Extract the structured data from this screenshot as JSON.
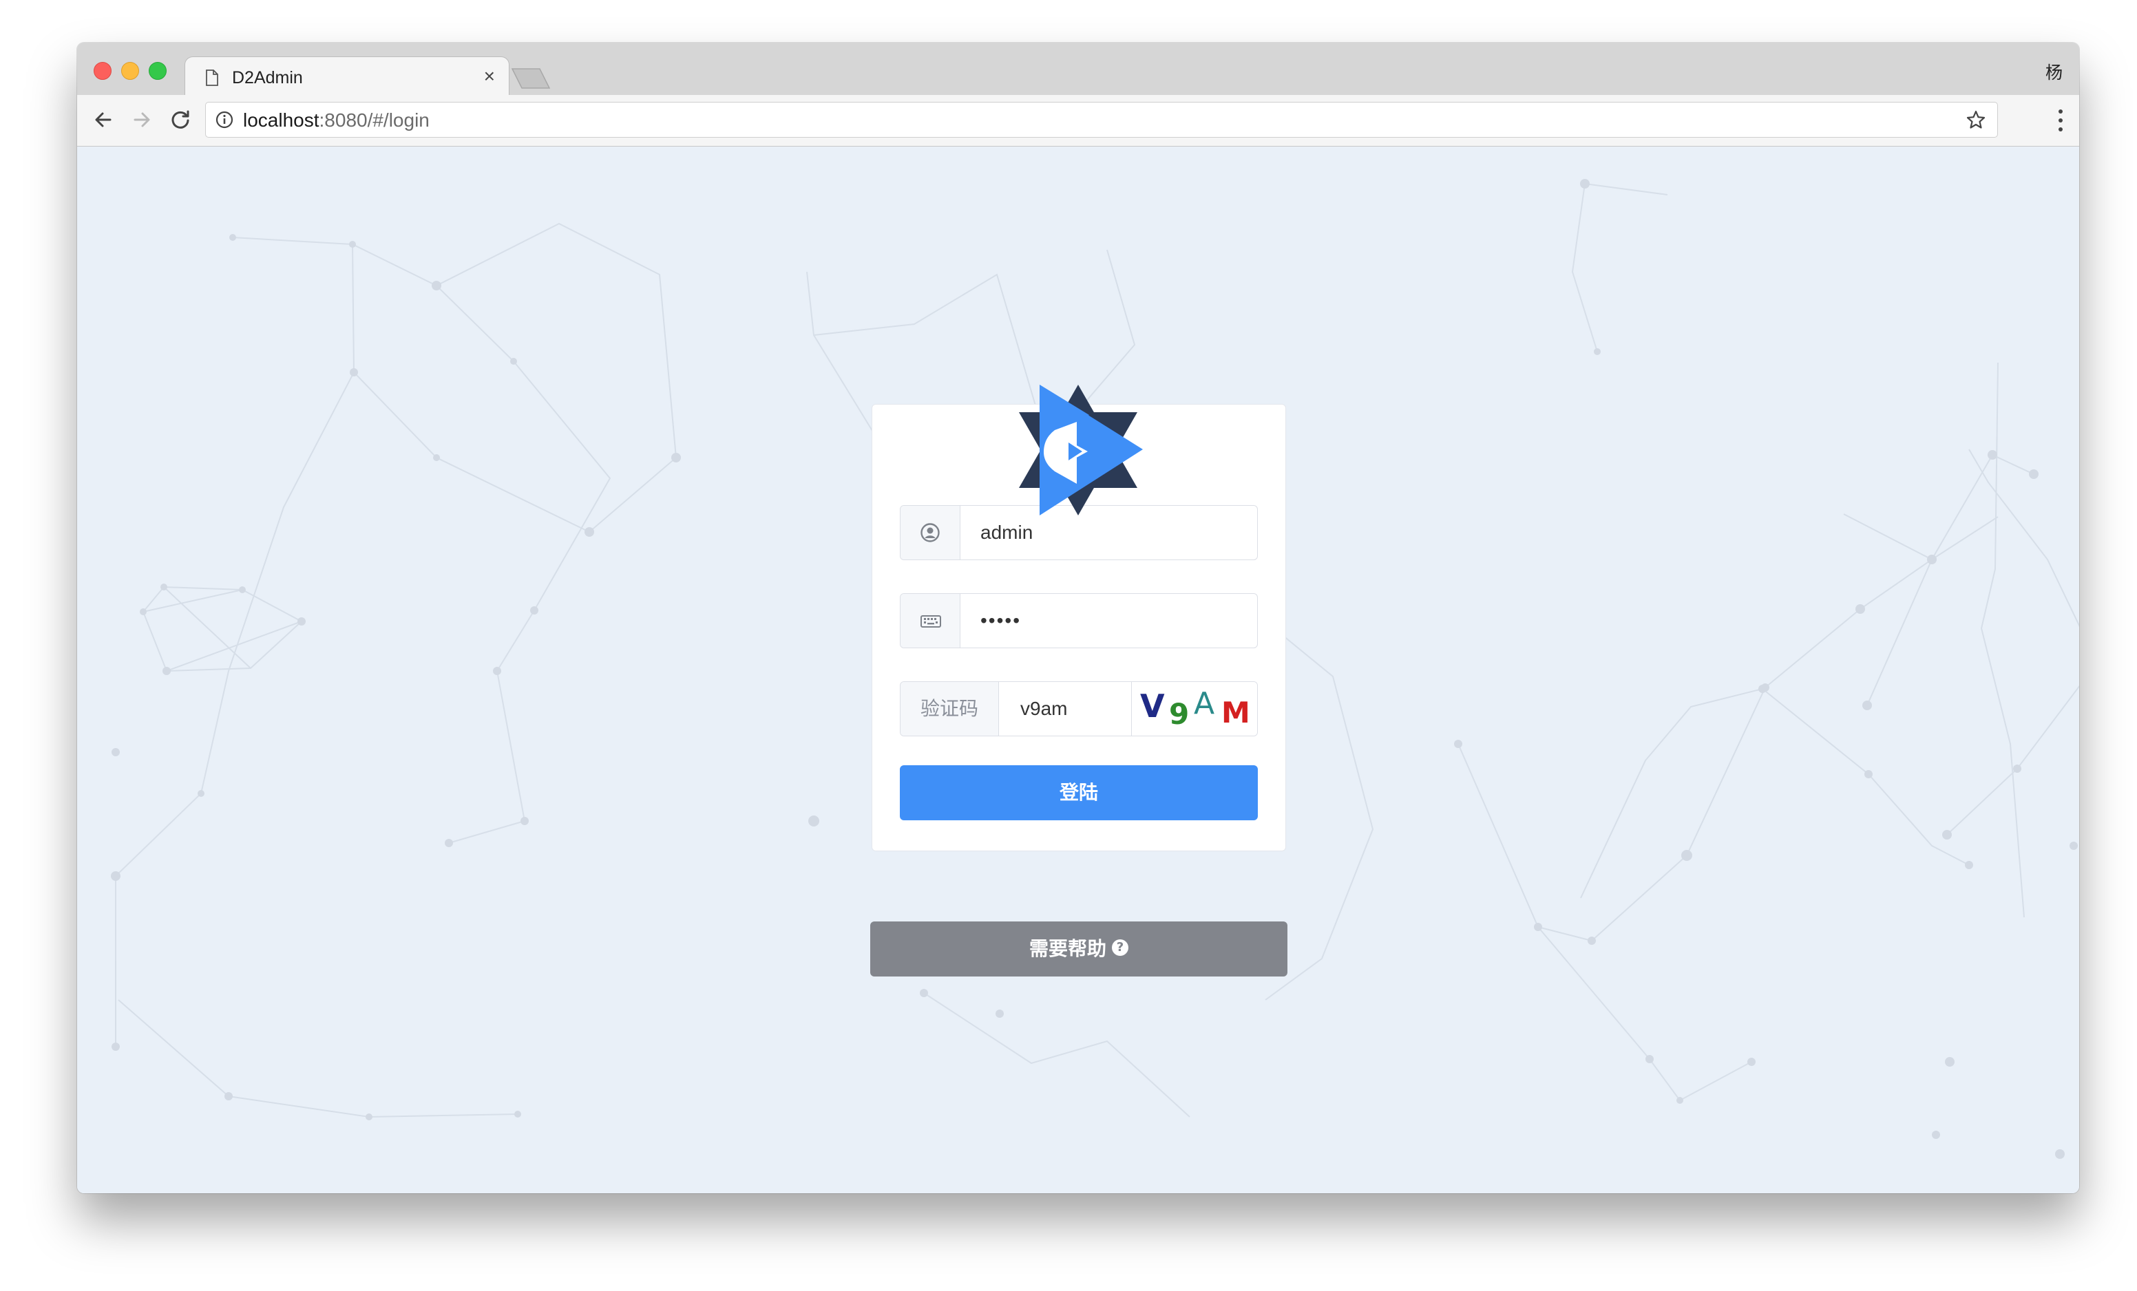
{
  "browser": {
    "tab_title": "D2Admin",
    "tab_close": "×",
    "profile_initial": "杨",
    "url_host": "localhost",
    "url_rest": ":8080/#/login"
  },
  "login": {
    "username_value": "admin",
    "password_value": "•••••",
    "code_label": "验证码",
    "code_value": "v9am",
    "captcha_chars": [
      "V",
      "9",
      "A",
      "M"
    ],
    "captcha_colors": [
      "#1f2a86",
      "#2e8b2e",
      "#2a8a8a",
      "#d42020"
    ],
    "login_button": "登陆",
    "help_button": "需要帮助",
    "help_icon_glyph": "?"
  },
  "colors": {
    "primary": "#3f8ff7",
    "help": "#82858c",
    "background": "#e9f0f8",
    "logo_blue": "#3f8ff7",
    "logo_dark": "#2b3a55"
  }
}
